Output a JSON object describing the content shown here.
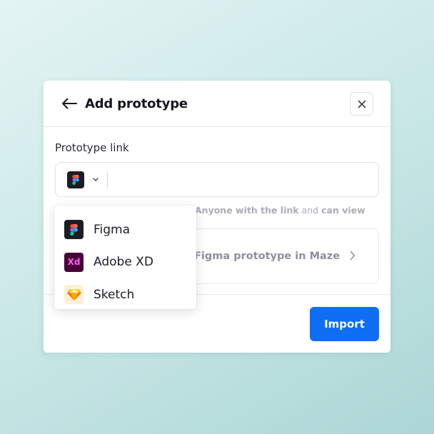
{
  "modal": {
    "title": "Add prototype",
    "field_label": "Prototype link",
    "url_value": "",
    "selected_tool": "figma",
    "hint": {
      "text_a": "Anyone with the link",
      "text_b": "and",
      "text_c": "can view"
    },
    "help_card": {
      "text": "Figma prototype in Maze"
    },
    "import_label": "Import"
  },
  "dropdown": {
    "items": [
      {
        "label": "Figma",
        "icon": "figma-logo-icon"
      },
      {
        "label": "Adobe XD",
        "icon": "adobe-xd-logo-icon",
        "mark": "Xd"
      },
      {
        "label": "Sketch",
        "icon": "sketch-logo-icon"
      }
    ]
  },
  "colors": {
    "primary": "#0f6ef4",
    "background_gradient": [
      "#e4f4f4",
      "#acd6d6"
    ],
    "xd_brand": "#ff61f6",
    "xd_bg": "#470137"
  }
}
